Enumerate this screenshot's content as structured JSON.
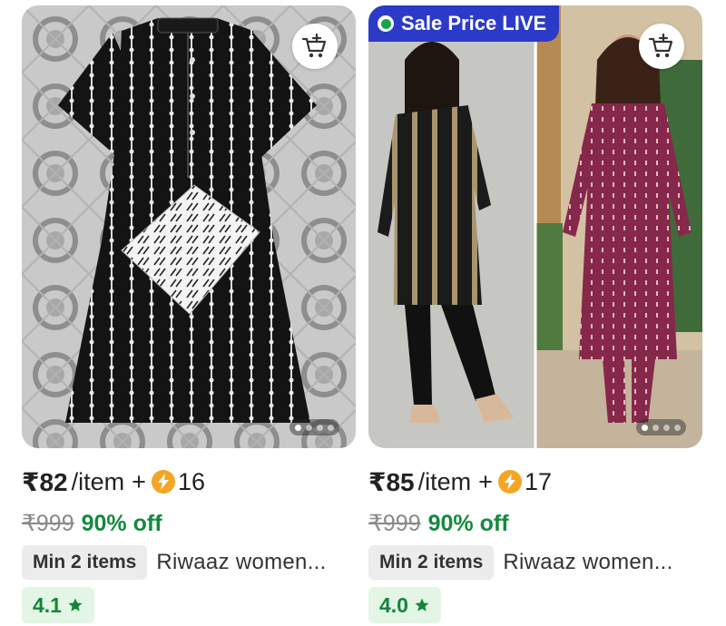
{
  "products": [
    {
      "price": "₹82",
      "per_unit": "/item",
      "plus": "+",
      "coins": "16",
      "mrp": "₹999",
      "discount": "90% off",
      "min_order": "Min 2 items",
      "title": "Riwaaz women...",
      "rating": "4.1",
      "image_count": 4,
      "active_image": 1
    },
    {
      "badge": "Sale Price LIVE",
      "price": "₹85",
      "per_unit": "/item",
      "plus": "+",
      "coins": "17",
      "mrp": "₹999",
      "discount": "90% off",
      "min_order": "Min 2 items",
      "title": "Riwaaz women...",
      "rating": "4.0",
      "image_count": 4,
      "active_image": 1
    }
  ],
  "icons": {
    "cart": "add-to-cart-icon",
    "coin": "lightning-coin-icon",
    "star": "star-icon",
    "live": "live-dot-icon"
  },
  "colors": {
    "sale_badge": "#2c3ac8",
    "discount": "#138a3c",
    "rating_bg": "#e3f6e6",
    "coin": "#f5a524",
    "kurta_black": "#151515",
    "kurta_maroon": "#8a2a4c"
  }
}
